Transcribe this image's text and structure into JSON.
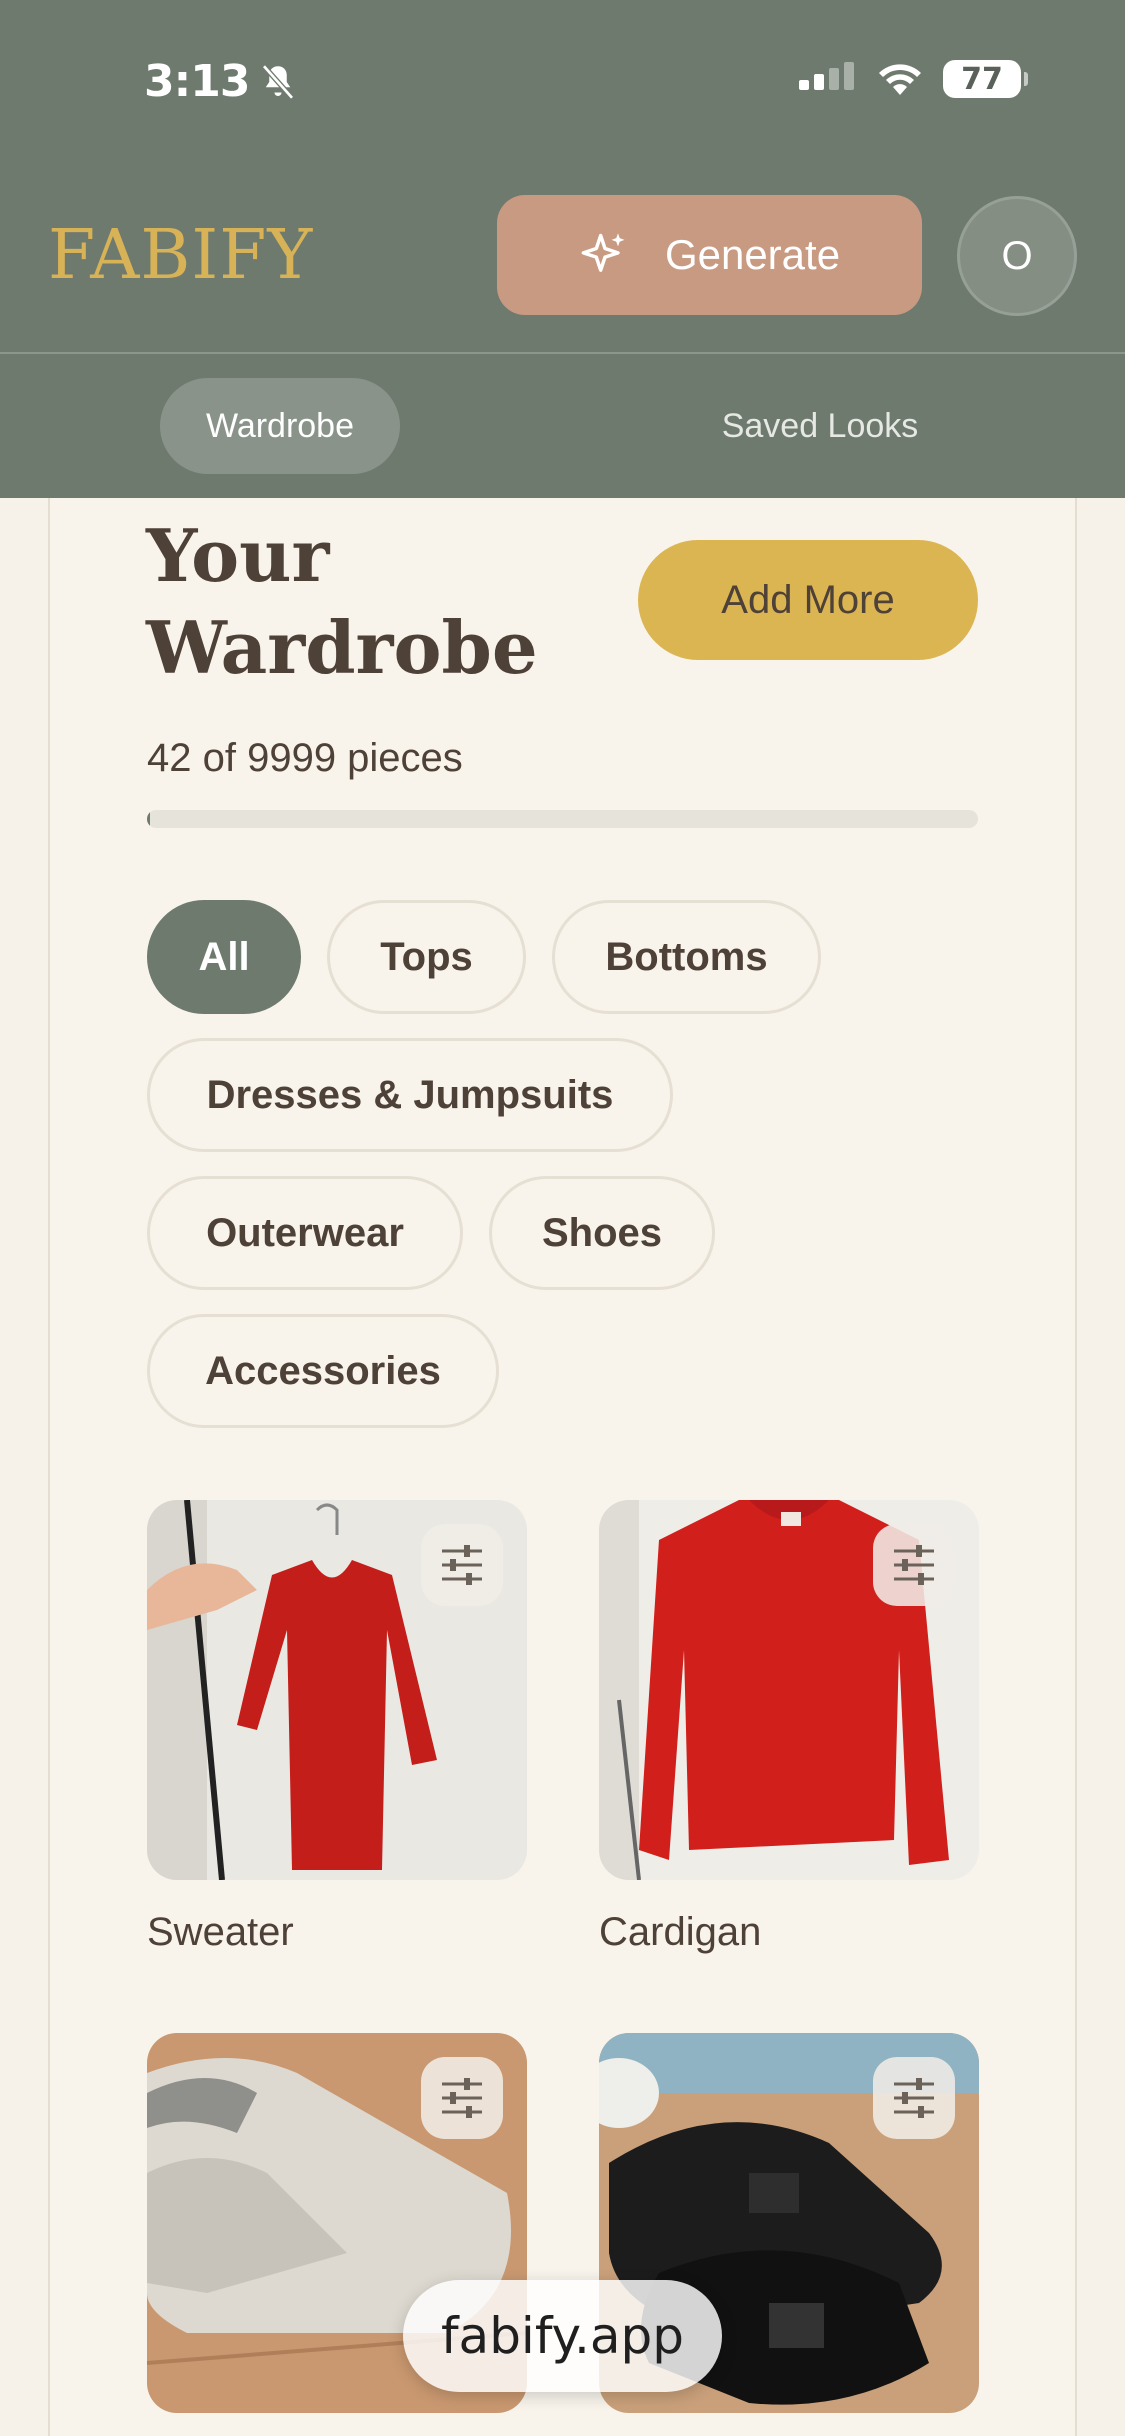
{
  "status_bar": {
    "time": "3:13",
    "battery": "77"
  },
  "header": {
    "logo": "FABIFY",
    "generate_label": "Generate",
    "avatar_initial": "O"
  },
  "tabs": [
    {
      "label": "Wardrobe",
      "active": true
    },
    {
      "label": "Saved Looks",
      "active": false
    }
  ],
  "main": {
    "title": "Your Wardrobe",
    "add_label": "Add More",
    "count_text": "42 of 9999 pieces",
    "progress_fraction": 0.0042
  },
  "filters": [
    {
      "label": "All",
      "active": true
    },
    {
      "label": "Tops",
      "active": false
    },
    {
      "label": "Bottoms",
      "active": false
    },
    {
      "label": "Dresses & Jumpsuits",
      "active": false
    },
    {
      "label": "Outerwear",
      "active": false
    },
    {
      "label": "Shoes",
      "active": false
    },
    {
      "label": "Accessories",
      "active": false
    }
  ],
  "items": [
    {
      "label": "Sweater",
      "image": "red-sweater-photo"
    },
    {
      "label": "Cardigan",
      "image": "red-cardigan-photo"
    },
    {
      "label": "",
      "image": "white-slip-on-shoes-photo"
    },
    {
      "label": "",
      "image": "black-sandals-photo"
    }
  ],
  "browser": {
    "url": "fabify.app"
  },
  "colors": {
    "header": "#6f7a6f",
    "accent_gold": "#dcb553",
    "generate": "#c99a82",
    "text": "#4e4138"
  }
}
